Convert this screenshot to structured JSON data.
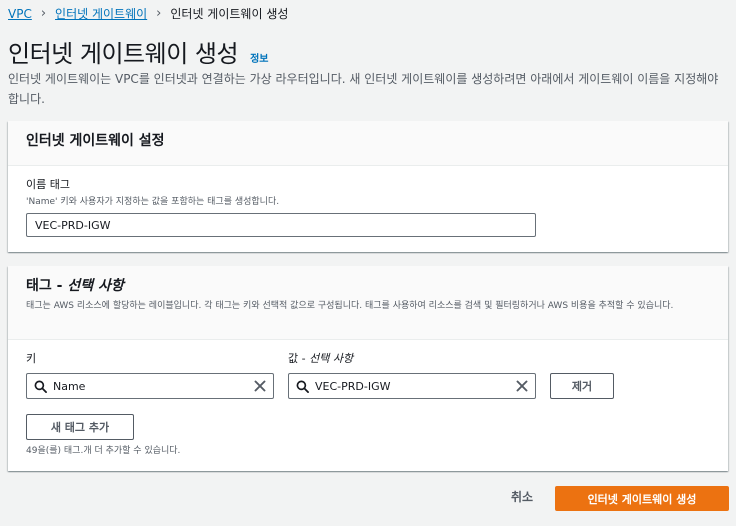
{
  "breadcrumb": {
    "items": [
      "VPC",
      "인터넷 게이트웨이"
    ],
    "current": "인터넷 게이트웨이 생성"
  },
  "page": {
    "title": "인터넷 게이트웨이 생성",
    "info": "정보",
    "description": "인터넷 게이트웨이는 VPC를 인터넷과 연결하는 가상 라우터입니다. 새 인터넷 게이트웨이를 생성하려면 아래에서 게이트웨이 이름을 지정해야 합니다."
  },
  "settings": {
    "title": "인터넷 게이트웨이 설정",
    "name_tag_label": "이름 태그",
    "name_tag_desc": "'Name' 키와 사용자가 지정하는 값을 포함하는 태그를 생성합니다.",
    "name_tag_value": "VEC-PRD-IGW"
  },
  "tags": {
    "title_main": "태그 - ",
    "title_optional": "선택 사항",
    "description": "태그는 AWS 리소스에 할당하는 레이블입니다. 각 태그는 키와 선택적 값으로 구성됩니다. 태그를 사용하여 리소스를 검색 및 필터링하거나 AWS 비용을 추적할 수 있습니다.",
    "key_label": "키",
    "value_label_main": "값 - ",
    "value_label_optional": "선택 사항",
    "key_value": "Name",
    "value_value": "VEC-PRD-IGW",
    "remove_label": "제거",
    "add_tag_label": "새 태그 추가",
    "remaining": "49을(를) 태그.개 더 추가할 수 있습니다."
  },
  "footer": {
    "cancel": "취소",
    "create": "인터넷 게이트웨이 생성"
  },
  "colors": {
    "link": "#0073bb",
    "primary_button": "#ec7211",
    "background": "#f2f3f3"
  }
}
